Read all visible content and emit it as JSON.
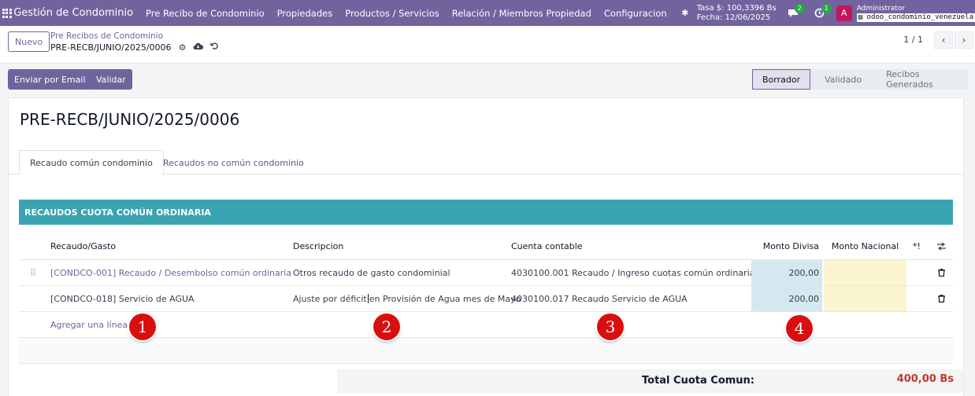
{
  "topbar": {
    "app_name": "Gestión de Condominio",
    "menus": [
      "Pre Recibo de Condominio",
      "Propiedades",
      "Productos / Servicios",
      "Relación / Miembros Propiedad",
      "Configuracion"
    ],
    "rate_line1": "Tasa $: 100,3396 Bs",
    "rate_line2": "Fecha: 12/06/2025",
    "messages_badge": "2",
    "activities_badge": "1",
    "avatar_letter": "A",
    "user_name": "Administrator",
    "db_name": "odoo_condominio_venezuela"
  },
  "control": {
    "new_label": "Nuevo",
    "breadcrumb_parent": "Pre Recibos de Condominio",
    "breadcrumb_current": "PRE-RECB/JUNIO/2025/0006",
    "pager": "1 / 1"
  },
  "actions": {
    "email_label": "Enviar por Email",
    "validate_label": "Validar",
    "statuses": [
      "Borrador",
      "Validado",
      "Recibos Generados"
    ]
  },
  "record": {
    "title": "PRE-RECB/JUNIO/2025/0006",
    "tabs": [
      "Recaudo común condominio",
      "Recaudos no común condominio"
    ],
    "section_title": "RECAUDOS CUOTA COMÚN ORDINARIA",
    "columns": {
      "recaudo": "Recaudo/Gasto",
      "descripcion": "Descripcion",
      "cuenta": "Cuenta contable",
      "monto_divisa": "Monto Divisa",
      "monto_nacional": "Monto Nacional",
      "warn": "*!"
    },
    "lines": [
      {
        "recaudo": "[CONDCO-001] Recaudo / Desembolso común ordinaria",
        "descripcion": "Otros recaudo de gasto condominial",
        "cuenta": "4030100.001 Recaudo / Ingreso cuotas común ordinaria",
        "monto_divisa": "200,00",
        "monto_nacional": ""
      },
      {
        "recaudo": "[CONDCO-018] Servicio de AGUA",
        "descripcion_a": "Ajuste por déficit",
        "descripcion_b": "en Provisión de Agua mes de Mayo",
        "cuenta": "4030100.017 Recaudo Servicio de AGUA",
        "monto_divisa": "200,00",
        "monto_nacional": ""
      }
    ],
    "add_line": "Agregar una línea",
    "annotations": [
      "1",
      "2",
      "3",
      "4"
    ],
    "total_label": "Total Cuota Comun:",
    "total_value": "400,00 Bs"
  },
  "colors": {
    "brand": "#71639e",
    "section": "#3aa3b2",
    "total": "#c0392b",
    "annotation": "#d90f0f"
  }
}
